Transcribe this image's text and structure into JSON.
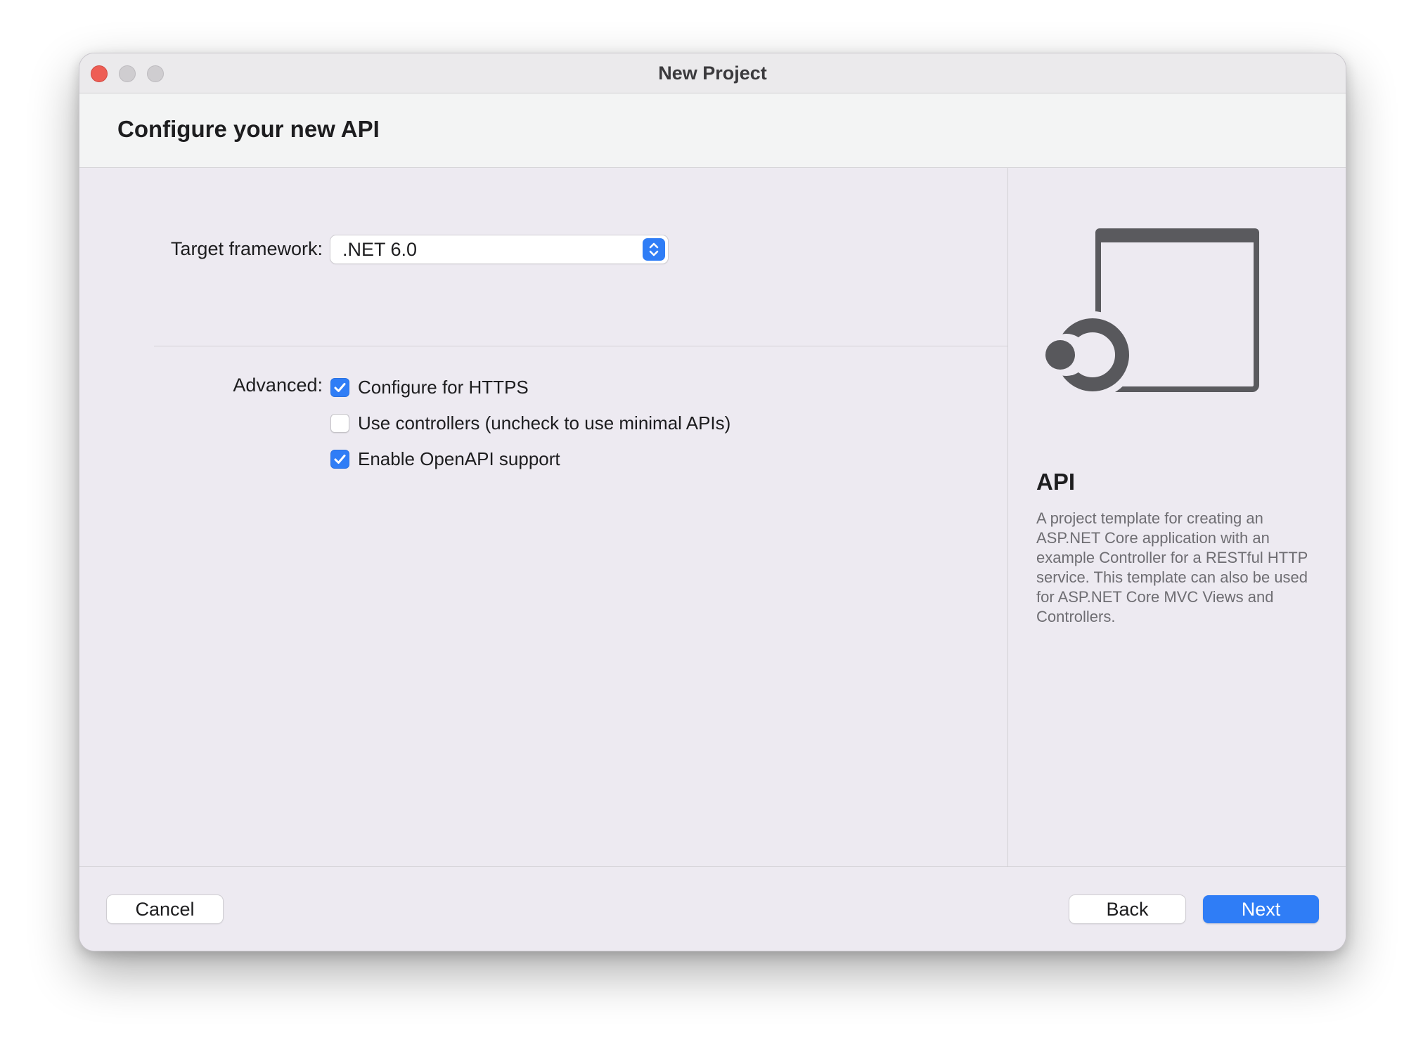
{
  "window": {
    "title": "New Project"
  },
  "header": {
    "title": "Configure your new API"
  },
  "form": {
    "target_framework": {
      "label": "Target framework:",
      "value": ".NET 6.0"
    },
    "advanced": {
      "label": "Advanced:",
      "options": [
        {
          "label": "Configure for HTTPS",
          "checked": true
        },
        {
          "label": "Use controllers (uncheck to use minimal APIs)",
          "checked": false
        },
        {
          "label": "Enable OpenAPI support",
          "checked": true
        }
      ]
    }
  },
  "template": {
    "icon": "api-template-icon",
    "name": "API",
    "description": "A project template for creating an ASP.NET Core application with an example Controller for a RESTful HTTP service. This template can also be used for ASP.NET Core MVC Views and Controllers."
  },
  "footer": {
    "cancel_label": "Cancel",
    "back_label": "Back",
    "next_label": "Next"
  },
  "colors": {
    "accent": "#2f7df6",
    "close_button": "#ee5e55",
    "window_background": "#edeaf1",
    "header_background": "#f3f4f4"
  }
}
